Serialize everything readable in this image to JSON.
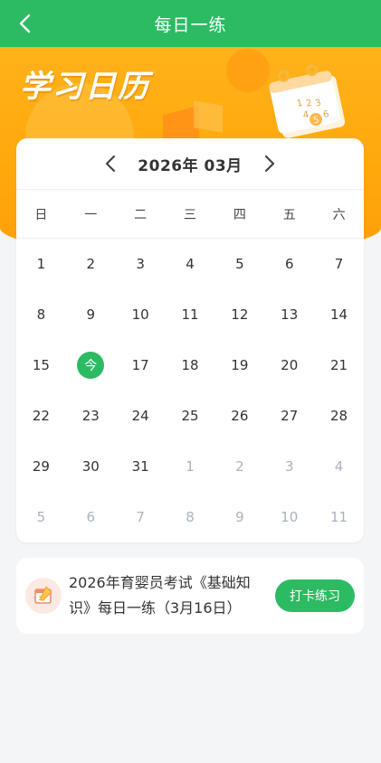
{
  "header": {
    "title": "每日一练",
    "back_icon": "chevron-left-icon"
  },
  "banner": {
    "brand_text": "学习日历",
    "calendar_art_numbers": [
      "1",
      "2",
      "3",
      "4",
      "5",
      "6"
    ]
  },
  "calendar": {
    "prev_icon": "chevron-left-icon",
    "next_icon": "chevron-right-icon",
    "year_month": "2026年  03月",
    "weekdays": [
      "日",
      "一",
      "二",
      "三",
      "四",
      "五",
      "六"
    ],
    "days": [
      {
        "label": "1",
        "other": false
      },
      {
        "label": "2",
        "other": false
      },
      {
        "label": "3",
        "other": false
      },
      {
        "label": "4",
        "other": false
      },
      {
        "label": "5",
        "other": false
      },
      {
        "label": "6",
        "other": false
      },
      {
        "label": "7",
        "other": false
      },
      {
        "label": "8",
        "other": false
      },
      {
        "label": "9",
        "other": false
      },
      {
        "label": "10",
        "other": false
      },
      {
        "label": "11",
        "other": false
      },
      {
        "label": "12",
        "other": false
      },
      {
        "label": "13",
        "other": false
      },
      {
        "label": "14",
        "other": false
      },
      {
        "label": "15",
        "other": false
      },
      {
        "label": "今",
        "other": false,
        "today": true
      },
      {
        "label": "17",
        "other": false
      },
      {
        "label": "18",
        "other": false
      },
      {
        "label": "19",
        "other": false
      },
      {
        "label": "20",
        "other": false
      },
      {
        "label": "21",
        "other": false
      },
      {
        "label": "22",
        "other": false
      },
      {
        "label": "23",
        "other": false
      },
      {
        "label": "24",
        "other": false
      },
      {
        "label": "25",
        "other": false
      },
      {
        "label": "26",
        "other": false
      },
      {
        "label": "27",
        "other": false
      },
      {
        "label": "28",
        "other": false
      },
      {
        "label": "29",
        "other": false
      },
      {
        "label": "30",
        "other": false
      },
      {
        "label": "31",
        "other": false
      },
      {
        "label": "1",
        "other": true
      },
      {
        "label": "2",
        "other": true
      },
      {
        "label": "3",
        "other": true
      },
      {
        "label": "4",
        "other": true
      },
      {
        "label": "5",
        "other": true
      },
      {
        "label": "6",
        "other": true
      },
      {
        "label": "7",
        "other": true
      },
      {
        "label": "8",
        "other": true
      },
      {
        "label": "9",
        "other": true
      },
      {
        "label": "10",
        "other": true
      },
      {
        "label": "11",
        "other": true
      }
    ]
  },
  "exam": {
    "icon": "calendar-pencil-icon",
    "title": "2026年育婴员考试《基础知识》每日一练（3月16日）",
    "button_label": "打卡练习"
  },
  "colors": {
    "primary": "#2cbb63",
    "banner": "#ffa80c",
    "muted_day": "#a9b3be"
  }
}
